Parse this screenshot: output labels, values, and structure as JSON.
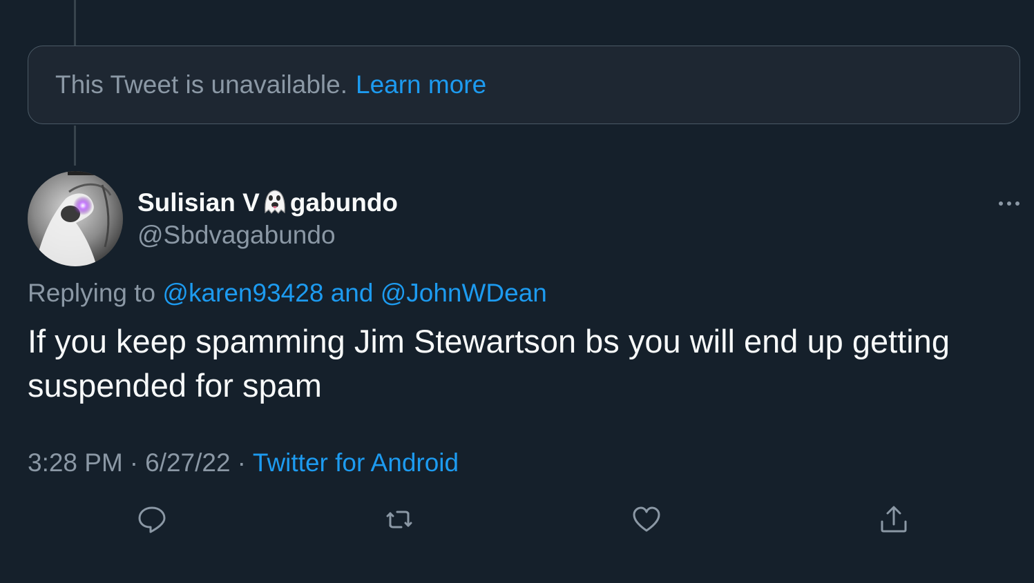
{
  "unavailable": {
    "message": "This Tweet is unavailable.",
    "learn_more": "Learn more"
  },
  "tweet": {
    "display_name_before": "Sulisian V",
    "display_name_emoji": "ghost-emoji",
    "display_name_after": "gabundo",
    "handle": "@Sbdvagabundo",
    "replying_prefix": "Replying to",
    "reply_to_1": "@karen93428",
    "reply_and": "and",
    "reply_to_2": "@JohnWDean",
    "text": "If you keep spamming Jim Stewartson bs you will end up getting suspended for spam",
    "time": "3:28 PM",
    "date": "6/27/22",
    "separator": "·",
    "source": "Twitter for Android"
  },
  "icons": {
    "more": "more-icon",
    "reply": "reply-icon",
    "retweet": "retweet-icon",
    "like": "heart-icon",
    "share": "share-icon"
  },
  "colors": {
    "background": "#15202b",
    "accent": "#1d9bf0",
    "secondary_text": "#8b98a5",
    "primary_text": "#f7f9f9"
  }
}
